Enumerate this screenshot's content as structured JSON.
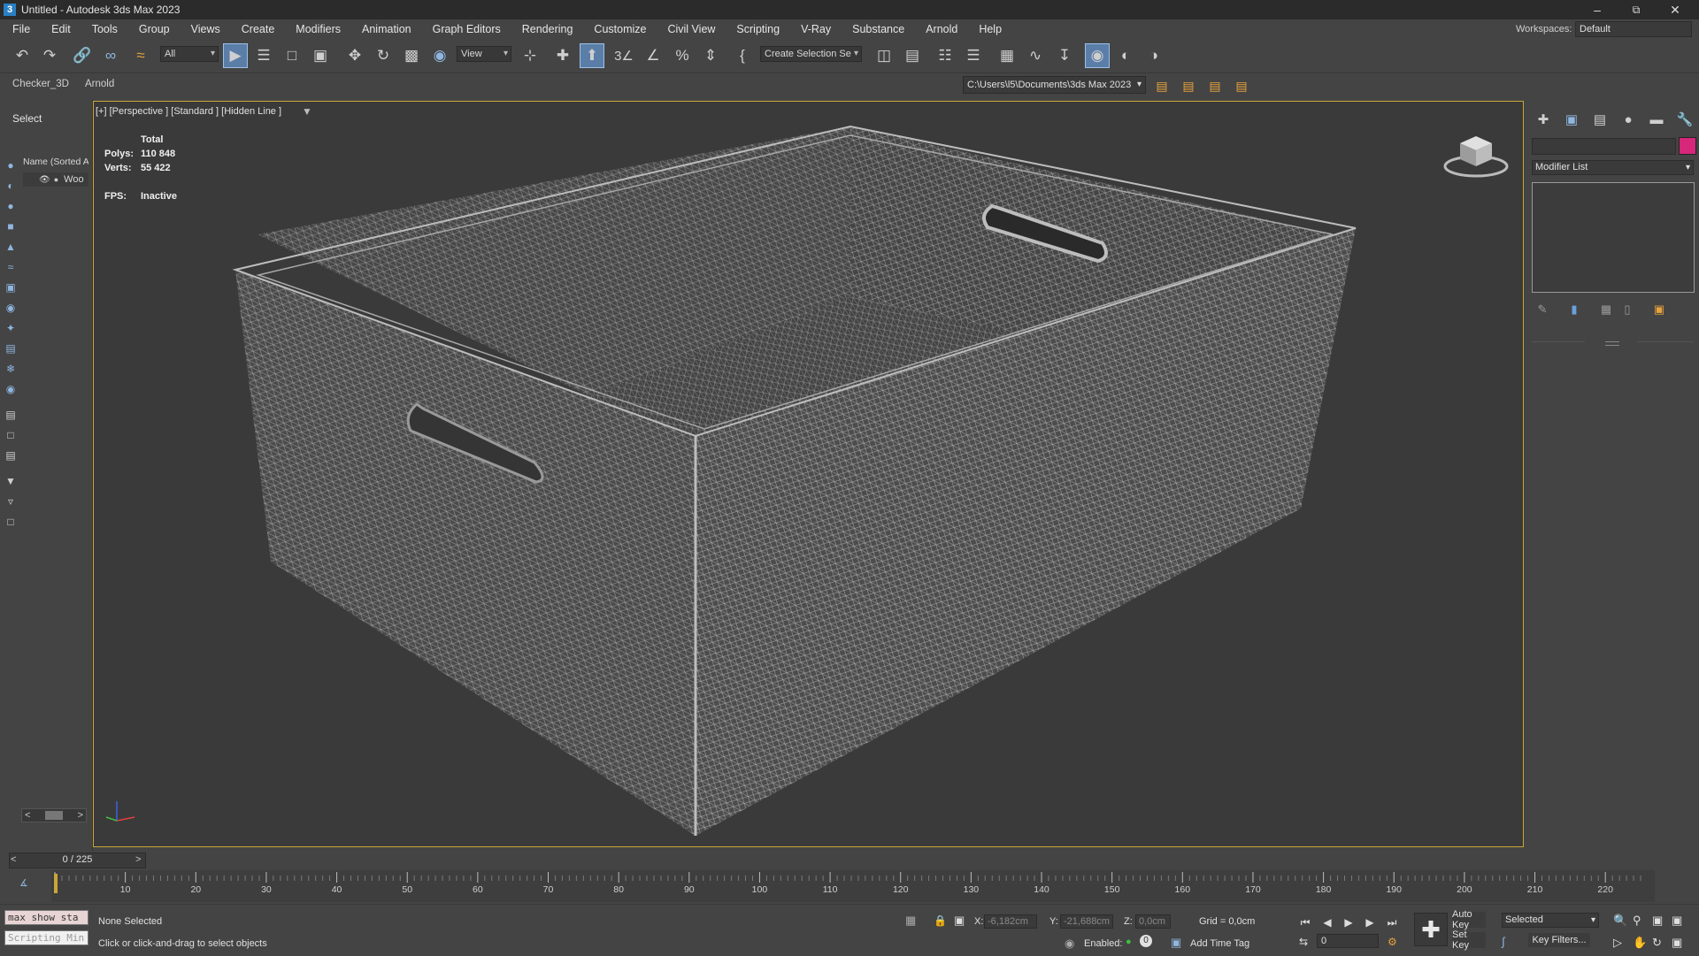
{
  "window": {
    "title": "Untitled - Autodesk 3ds Max 2023",
    "app_icon_letter": "3"
  },
  "menu": [
    "File",
    "Edit",
    "Tools",
    "Group",
    "Views",
    "Create",
    "Modifiers",
    "Animation",
    "Graph Editors",
    "Rendering",
    "Customize",
    "Civil View",
    "Scripting",
    "V-Ray",
    "Substance",
    "Arnold",
    "Help"
  ],
  "workspace": {
    "label": "Workspaces:",
    "value": "Default"
  },
  "toolbar": {
    "filter_value": "All",
    "ref_coord_value": "View",
    "selection_set_value": "Create Selection Se"
  },
  "subbar": {
    "tabs": [
      "Checker_3D",
      "Arnold"
    ],
    "project_path": "C:\\Users\\l5\\Documents\\3ds Max 2023"
  },
  "explorer": {
    "select_label": "Select",
    "name_header": "Name (Sorted A",
    "node_name": "Woo"
  },
  "viewport": {
    "label": "[+] [Perspective ] [Standard ] [Hidden Line ]",
    "stats": {
      "total_label": "Total",
      "polys_label": "Polys:",
      "polys_value": "110 848",
      "verts_label": "Verts:",
      "verts_value": "55 422",
      "fps_label": "FPS:",
      "fps_value": "Inactive"
    }
  },
  "command_panel": {
    "modifier_list_label": "Modifier List",
    "object_color": "#d6277a"
  },
  "timeline": {
    "slider_text": "0 / 225",
    "ticks": [
      "10",
      "20",
      "30",
      "40",
      "50",
      "60",
      "70",
      "80",
      "90",
      "100",
      "110",
      "120",
      "130",
      "140",
      "150",
      "160",
      "170",
      "180",
      "190",
      "200",
      "210",
      "220"
    ]
  },
  "status": {
    "maxscript_line1": "max show sta",
    "maxscript_line2": "Scripting Min",
    "selection_text": "None Selected",
    "prompt_text": "Click or click-and-drag to select objects",
    "x_label": "X:",
    "x_value": "-6,182cm",
    "y_label": "Y:",
    "y_value": "-21,688cm",
    "z_label": "Z:",
    "z_value": "0,0cm",
    "grid_text": "Grid = 0,0cm",
    "enabled_label": "Enabled:",
    "add_time_tag": "Add Time Tag",
    "auto_key": "Auto Key",
    "set_key": "Set Key",
    "selected_value": "Selected",
    "key_filters": "Key Filters...",
    "current_frame": "0"
  },
  "colors": {
    "viewport_border": "#c9a637",
    "active_tool": "#5b7ea8",
    "mesh_wire": "#b9b9b9"
  }
}
